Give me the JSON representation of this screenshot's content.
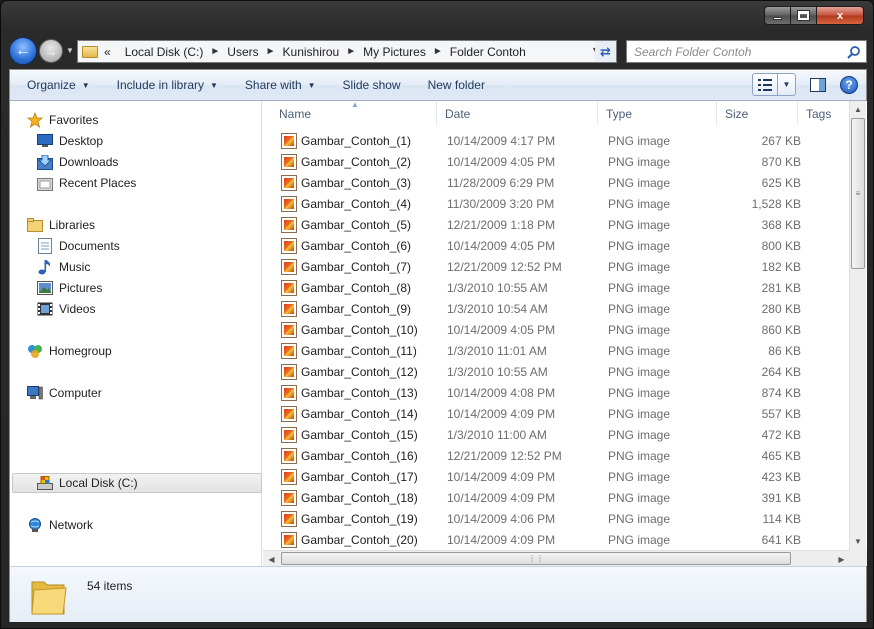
{
  "window": {
    "controls": {
      "minimize_icon": "minimize-icon",
      "maximize_icon": "maximize-icon",
      "close_label": "x"
    }
  },
  "address": {
    "overflow": "«",
    "crumbs": [
      "Local Disk (C:)",
      "Users",
      "Kunishirou",
      "My Pictures",
      "Folder Contoh"
    ]
  },
  "search": {
    "placeholder": "Search Folder Contoh"
  },
  "toolbar": {
    "organize": "Organize",
    "include_in_library": "Include in library",
    "share_with": "Share with",
    "slide_show": "Slide show",
    "new_folder": "New folder",
    "help": "?"
  },
  "nav": {
    "favorites": "Favorites",
    "desktop": "Desktop",
    "downloads": "Downloads",
    "recent_places": "Recent Places",
    "libraries": "Libraries",
    "documents": "Documents",
    "music": "Music",
    "pictures": "Pictures",
    "videos": "Videos",
    "homegroup": "Homegroup",
    "computer": "Computer",
    "local_disk": "Local Disk (C:)",
    "network": "Network"
  },
  "columns": {
    "name": "Name",
    "date": "Date",
    "type": "Type",
    "size": "Size",
    "tags": "Tags"
  },
  "files": [
    {
      "name": "Gambar_Contoh_(1)",
      "date": "10/14/2009 4:17 PM",
      "type": "PNG image",
      "size": "267 KB"
    },
    {
      "name": "Gambar_Contoh_(2)",
      "date": "10/14/2009 4:05 PM",
      "type": "PNG image",
      "size": "870 KB"
    },
    {
      "name": "Gambar_Contoh_(3)",
      "date": "11/28/2009 6:29 PM",
      "type": "PNG image",
      "size": "625 KB"
    },
    {
      "name": "Gambar_Contoh_(4)",
      "date": "11/30/2009 3:20 PM",
      "type": "PNG image",
      "size": "1,528 KB"
    },
    {
      "name": "Gambar_Contoh_(5)",
      "date": "12/21/2009 1:18 PM",
      "type": "PNG image",
      "size": "368 KB"
    },
    {
      "name": "Gambar_Contoh_(6)",
      "date": "10/14/2009 4:05 PM",
      "type": "PNG image",
      "size": "800 KB"
    },
    {
      "name": "Gambar_Contoh_(7)",
      "date": "12/21/2009 12:52 PM",
      "type": "PNG image",
      "size": "182 KB"
    },
    {
      "name": "Gambar_Contoh_(8)",
      "date": "1/3/2010 10:55 AM",
      "type": "PNG image",
      "size": "281 KB"
    },
    {
      "name": "Gambar_Contoh_(9)",
      "date": "1/3/2010 10:54 AM",
      "type": "PNG image",
      "size": "280 KB"
    },
    {
      "name": "Gambar_Contoh_(10)",
      "date": "10/14/2009 4:05 PM",
      "type": "PNG image",
      "size": "860 KB"
    },
    {
      "name": "Gambar_Contoh_(11)",
      "date": "1/3/2010 11:01 AM",
      "type": "PNG image",
      "size": "86 KB"
    },
    {
      "name": "Gambar_Contoh_(12)",
      "date": "1/3/2010 10:55 AM",
      "type": "PNG image",
      "size": "264 KB"
    },
    {
      "name": "Gambar_Contoh_(13)",
      "date": "10/14/2009 4:08 PM",
      "type": "PNG image",
      "size": "874 KB"
    },
    {
      "name": "Gambar_Contoh_(14)",
      "date": "10/14/2009 4:09 PM",
      "type": "PNG image",
      "size": "557 KB"
    },
    {
      "name": "Gambar_Contoh_(15)",
      "date": "1/3/2010 11:00 AM",
      "type": "PNG image",
      "size": "472 KB"
    },
    {
      "name": "Gambar_Contoh_(16)",
      "date": "12/21/2009 12:52 PM",
      "type": "PNG image",
      "size": "465 KB"
    },
    {
      "name": "Gambar_Contoh_(17)",
      "date": "10/14/2009 4:09 PM",
      "type": "PNG image",
      "size": "423 KB"
    },
    {
      "name": "Gambar_Contoh_(18)",
      "date": "10/14/2009 4:09 PM",
      "type": "PNG image",
      "size": "391 KB"
    },
    {
      "name": "Gambar_Contoh_(19)",
      "date": "10/14/2009 4:06 PM",
      "type": "PNG image",
      "size": "114 KB"
    },
    {
      "name": "Gambar_Contoh_(20)",
      "date": "10/14/2009 4:09 PM",
      "type": "PNG image",
      "size": "641 KB"
    }
  ],
  "details": {
    "count": "54 items"
  },
  "colors": {
    "accent": "#1e395b",
    "toolbar_bg": "#dae5f3",
    "secondary_text": "#6d6d6d"
  }
}
